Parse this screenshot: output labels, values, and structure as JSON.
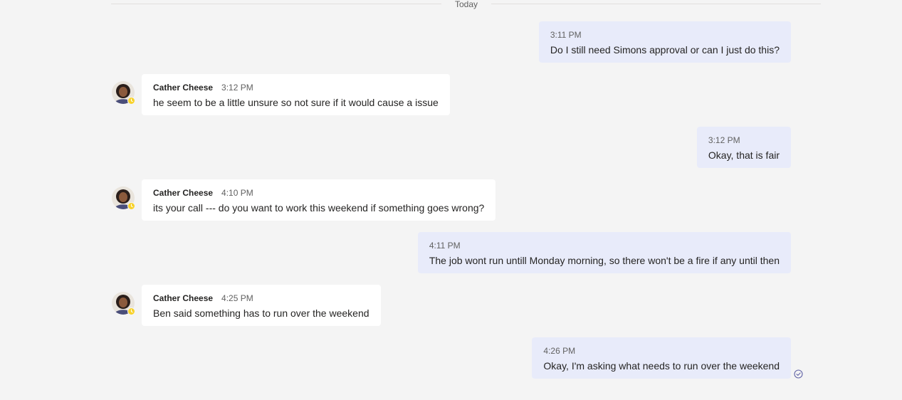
{
  "divider": {
    "label": "Today"
  },
  "messages": [
    {
      "direction": "out",
      "time": "3:11 PM",
      "text": "Do I still need Simons approval or can I just do this?"
    },
    {
      "direction": "in",
      "sender": "Cather Cheese",
      "time": "3:12 PM",
      "text": "he seem to be a little unsure so not sure if it would cause a issue"
    },
    {
      "direction": "out",
      "time": "3:12 PM",
      "text": "Okay, that is fair"
    },
    {
      "direction": "in",
      "sender": "Cather Cheese",
      "time": "4:10 PM",
      "text": "its your call --- do you want to work this weekend if something goes wrong?"
    },
    {
      "direction": "out",
      "time": "4:11 PM",
      "text": "The job wont run untill Monday morning, so there won't be a fire if any until then"
    },
    {
      "direction": "in",
      "sender": "Cather Cheese",
      "time": "4:25 PM",
      "text": "Ben said something has to run over the weekend"
    },
    {
      "direction": "out",
      "time": "4:26 PM",
      "text": "Okay, I'm asking what needs to run over the weekend"
    }
  ],
  "presence": {
    "status": "away",
    "color": "#f8d22a"
  },
  "colors": {
    "outgoing_bubble": "#e8ebfa",
    "incoming_bubble": "#ffffff",
    "background": "#f4f4f4",
    "accent": "#6264a7"
  },
  "icons": {
    "read_receipt": "check-circle-icon",
    "presence": "clock-icon"
  }
}
